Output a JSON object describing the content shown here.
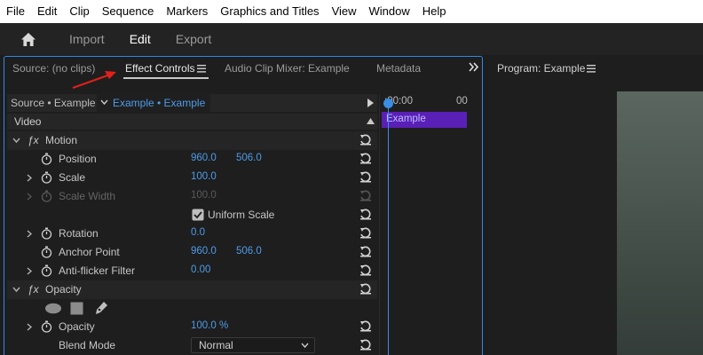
{
  "menu": [
    "File",
    "Edit",
    "Clip",
    "Sequence",
    "Markers",
    "Graphics and Titles",
    "View",
    "Window",
    "Help"
  ],
  "workspace": {
    "tabs": [
      {
        "label": "Import",
        "active": false
      },
      {
        "label": "Edit",
        "active": true
      },
      {
        "label": "Export",
        "active": false
      }
    ]
  },
  "effect_panel": {
    "tabs": {
      "source": "Source: (no clips)",
      "effect_controls": "Effect Controls",
      "audio_mixer": "Audio Clip Mixer: Example",
      "metadata": "Metadata"
    },
    "source_label": "Source • Example",
    "clip_label": "Example • Example",
    "video_header": "Video",
    "motion": {
      "label": "Motion",
      "position": {
        "label": "Position",
        "x": "960.0",
        "y": "506.0"
      },
      "scale": {
        "label": "Scale",
        "value": "100.0"
      },
      "scale_width": {
        "label": "Scale Width",
        "value": "100.0"
      },
      "uniform_scale": {
        "label": "Uniform Scale",
        "checked": true
      },
      "rotation": {
        "label": "Rotation",
        "value": "0.0"
      },
      "anchor": {
        "label": "Anchor Point",
        "x": "960.0",
        "y": "506.0"
      },
      "antiflicker": {
        "label": "Anti-flicker Filter",
        "value": "0.00"
      }
    },
    "opacity": {
      "label": "Opacity",
      "opacity": {
        "label": "Opacity",
        "value": "100.0 %"
      },
      "blend": {
        "label": "Blend Mode",
        "value": "Normal"
      }
    },
    "timeline": {
      "start": ":00:00",
      "end": "00",
      "clip": "Example"
    }
  },
  "program": {
    "title": "Program: Example"
  },
  "colors": {
    "accent": "#2d8ceb",
    "value": "#4e9be8",
    "clip_bar": "#5a1fb7",
    "annotation": "#e0201b"
  }
}
